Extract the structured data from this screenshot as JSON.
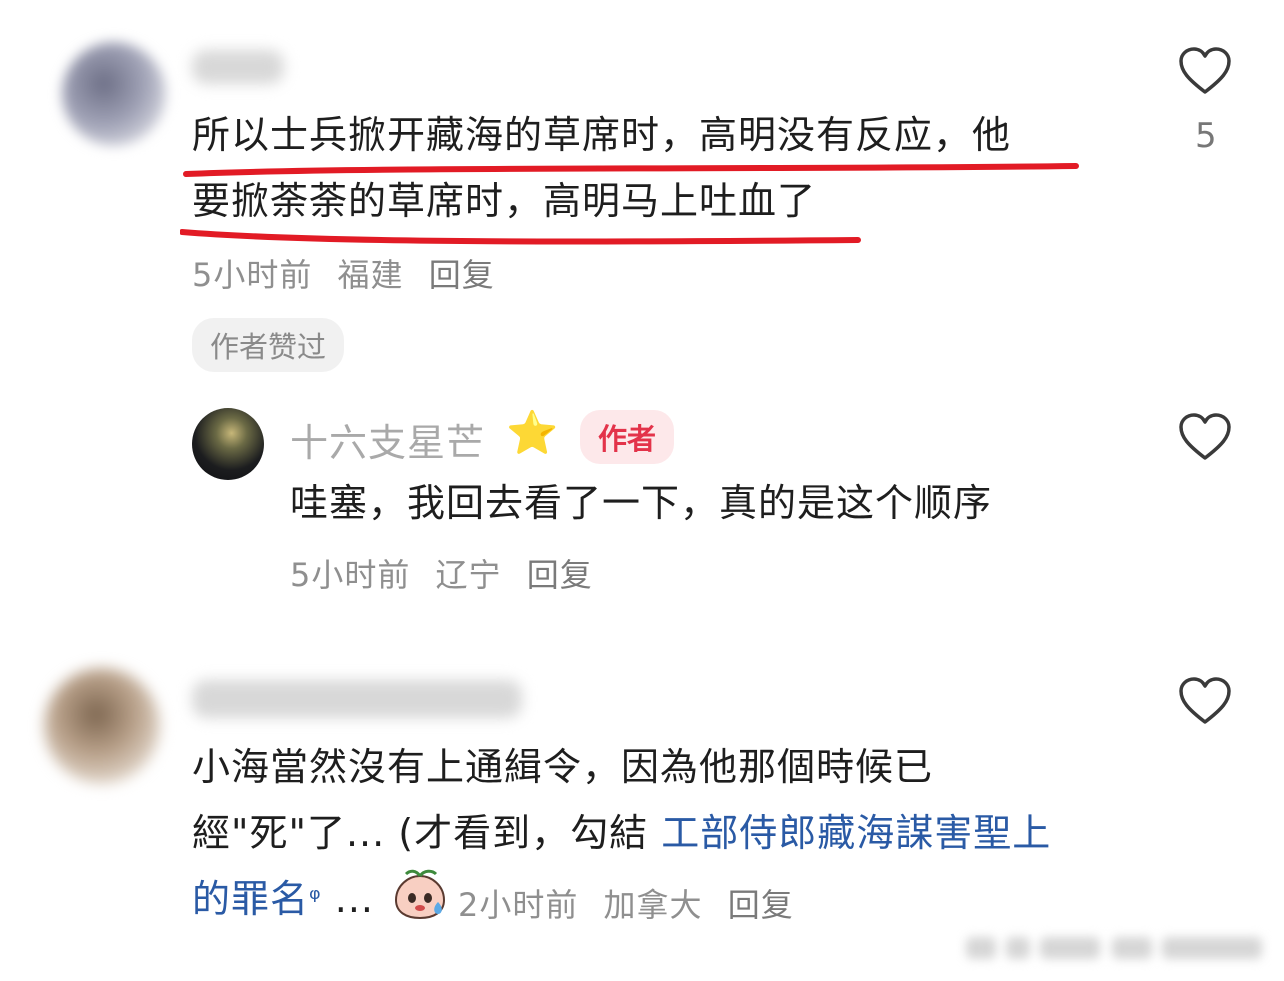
{
  "comments": [
    {
      "text_lines": [
        "所以士兵掀开藏海的草席时，高明没有反应，他",
        "要掀荼荼的草席时，高明马上吐血了"
      ],
      "time": "5小时前",
      "location": "福建",
      "reply_label": "回复",
      "badge": "作者赞过",
      "like_count": "5",
      "highlight_color": "#e21b25"
    },
    {
      "username": "十六支星芒",
      "name_emoji": "⭐",
      "author_tag": "作者",
      "text": "哇塞，我回去看了一下，真的是这个顺序",
      "time": "5小时前",
      "location": "辽宁",
      "reply_label": "回复"
    },
    {
      "text_lines": [
        "小海當然沒有上通緝令，因為他那個時候已",
        "經\"死\"了... (才看到，勾結 "
      ],
      "link_text_1": "工部侍郎藏海謀害聖上",
      "link_text_2": "的罪名",
      "link_icon": "ᵠ",
      "ellipsis": "...",
      "time": "2小时前",
      "location": "加拿大",
      "reply_label": "回复"
    }
  ],
  "colors": {
    "link": "#2a5aa5",
    "tag_bg": "#fde8ea",
    "tag_text": "#e3334a"
  }
}
